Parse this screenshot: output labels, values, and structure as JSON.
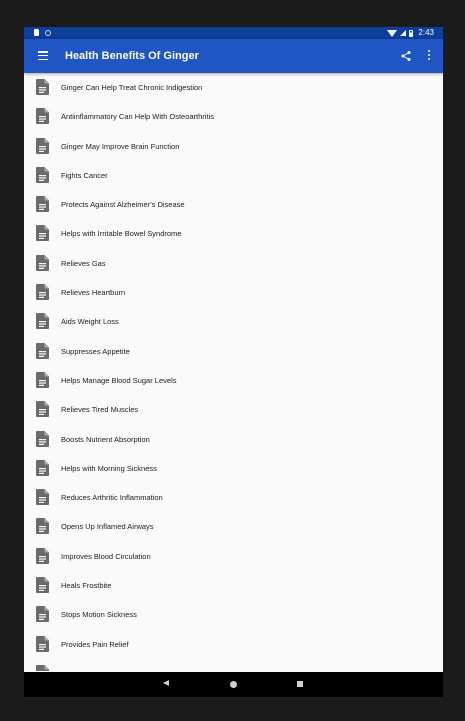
{
  "status_bar": {
    "time": "2:43",
    "icons": [
      "sd-card-icon",
      "sync-icon",
      "wifi-icon",
      "signal-icon",
      "battery-icon"
    ]
  },
  "app_bar": {
    "title": "Health Benefits Of Ginger",
    "icons": [
      "menu-icon",
      "share-icon",
      "more-vert-icon"
    ],
    "color": "#1f56c4"
  },
  "list": {
    "item_icon": "document-icon",
    "items": [
      "Ginger Can Help Treat Chronic Indigestion",
      "Antiinflammatory Can Help With Osteoarthritis",
      "Ginger May Improve Brain Function",
      "Fights Cancer",
      "Protects Against Alzheimer's Disease",
      "Helps with Irritable Bowel Syndrome",
      "Relieves Gas",
      "Relieves Heartburn",
      "Aids Weight Loss",
      "Suppresses Appetite",
      "Helps Manage Blood Sugar Levels",
      "Relieves Tired Muscles",
      "Boosts Nutrient Absorption",
      "Helps with Morning Sickness",
      "Reduces Arthritic Inflammation",
      "Opens Up Inflamed Airways",
      "Improves Blood Circulation",
      "Heals Frostbite",
      "Stops Motion Sickness",
      "Provides Pain Relief"
    ]
  },
  "nav_bar": {
    "icons": [
      "back-icon",
      "home-icon",
      "recents-icon"
    ]
  }
}
